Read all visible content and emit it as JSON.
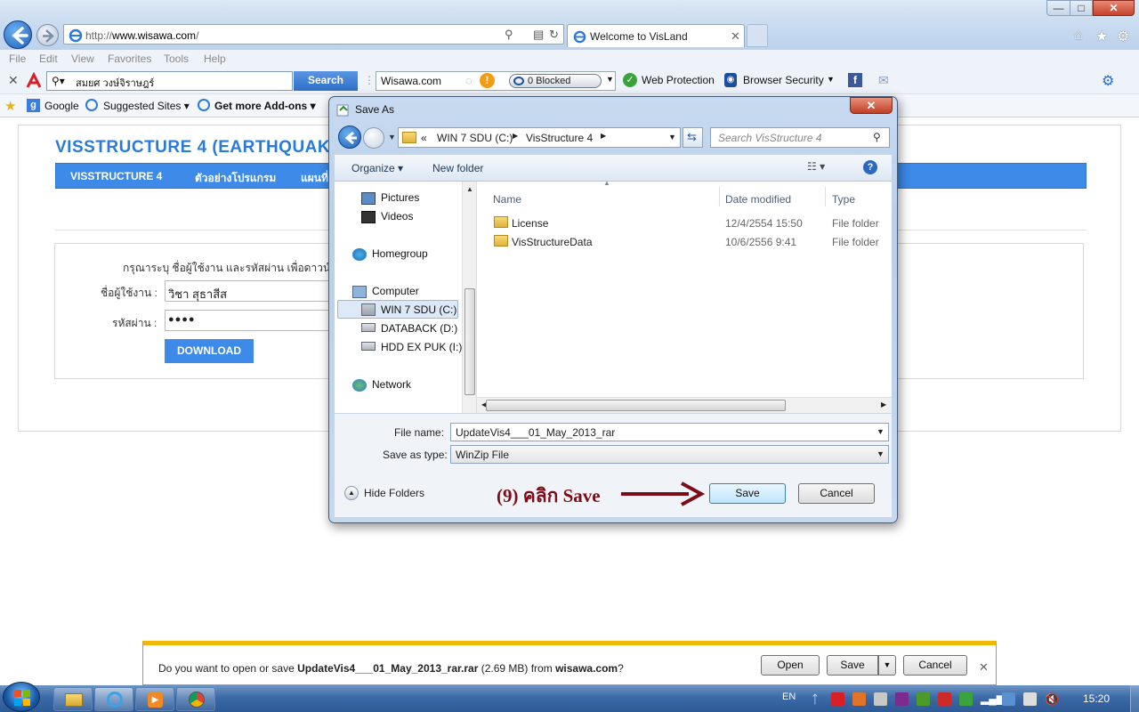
{
  "browser": {
    "url_prefix": "http://",
    "url_domain": "www.wisawa.com",
    "url_suffix": "/",
    "tab_title": "Welcome to VisLand",
    "menu": [
      "File",
      "Edit",
      "View",
      "Favorites",
      "Tools",
      "Help"
    ],
    "toolbar": {
      "search_value": "สมยศ วงษ์จิราษฎร์",
      "search_button": "Search",
      "site_box": "Wisawa.com",
      "blocked_label": "0 Blocked",
      "web_protection": "Web Protection",
      "browser_security": "Browser Security"
    },
    "favorites": {
      "google": "Google",
      "suggested": "Suggested Sites",
      "addons": "Get more Add-ons"
    }
  },
  "page": {
    "site_title": "VISSTRUCTURE 4 (EARTHQUAKE",
    "nav": [
      "VISSTRUCTURE 4",
      "ตัวอย่างโปรแกรม",
      "แผนที่"
    ],
    "login_prompt": "กรุณาระบุ ชื่อผู้ใช้งาน และรหัสผ่าน เพื่อดาวน์โหล",
    "username_label": "ชื่อผู้ใช้งาน :",
    "username_value": "วิชา สุธาสีส",
    "password_label": "รหัสผ่าน :",
    "password_value": "●●●●",
    "download_button": "DOWNLOAD"
  },
  "dialog": {
    "title": "Save As",
    "breadcrumb": [
      "«",
      "WIN 7 SDU (C:)",
      "VisStructure 4"
    ],
    "search_placeholder": "Search VisStructure 4",
    "organize": "Organize",
    "new_folder": "New folder",
    "nav_items": [
      "Pictures",
      "Videos",
      "Homegroup",
      "Computer",
      "WIN 7 SDU (C:)",
      "DATABACK (D:)",
      "HDD EX PUK (I:)",
      "Network"
    ],
    "columns": [
      "Name",
      "Date modified",
      "Type"
    ],
    "files": [
      {
        "name": "License",
        "date": "12/4/2554 15:50",
        "type": "File folder"
      },
      {
        "name": "VisStructureData",
        "date": "10/6/2556 9:41",
        "type": "File folder"
      }
    ],
    "file_name_label": "File name:",
    "file_name_value": "UpdateVis4___01_May_2013_rar",
    "save_type_label": "Save as type:",
    "save_type_value": "WinZip File",
    "hide_folders": "Hide Folders",
    "save_button": "Save",
    "cancel_button": "Cancel"
  },
  "annotation": "(9) คลิก Save",
  "notification": {
    "prefix": "Do you want to open or save ",
    "filename": "UpdateVis4___01_May_2013_rar.rar",
    "size": " (2.69 MB) from ",
    "site": "wisawa.com",
    "suffix": "?",
    "open_button": "Open",
    "save_button": "Save",
    "cancel_button": "Cancel"
  },
  "taskbar": {
    "lang": "EN",
    "clock": "15:20"
  },
  "colors": {
    "site_blue": "#3d8ae8",
    "annotation_red": "#7b0d18",
    "notify_yellow": "#f2b705"
  }
}
